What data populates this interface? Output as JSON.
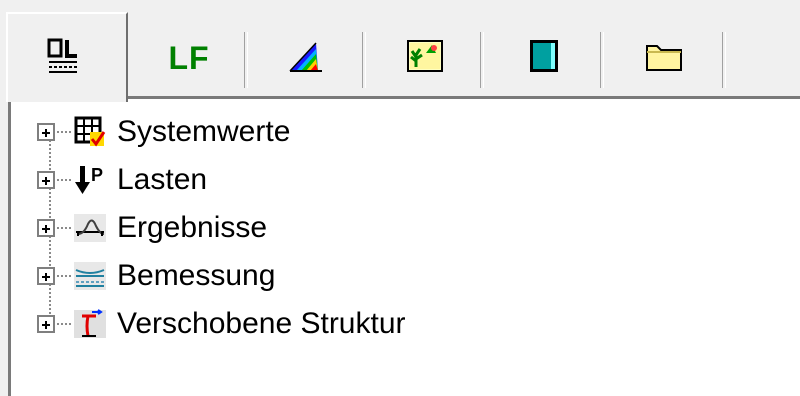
{
  "tabs": [
    {
      "id": "pl",
      "icon": "pl-tab-icon",
      "active": true
    },
    {
      "id": "lf",
      "label": "LF",
      "icon": "lf-text-icon"
    },
    {
      "id": "spectrum",
      "icon": "color-spectrum-icon"
    },
    {
      "id": "plant",
      "icon": "plant-image-icon"
    },
    {
      "id": "cyan",
      "icon": "cyan-frame-icon"
    },
    {
      "id": "folder",
      "icon": "folder-icon"
    }
  ],
  "tree": {
    "items": [
      {
        "label": "Systemwerte",
        "icon": "grid-check-icon",
        "expanded": false
      },
      {
        "label": "Lasten",
        "icon": "load-arrow-icon",
        "expanded": false
      },
      {
        "label": "Ergebnisse",
        "icon": "results-curve-icon",
        "expanded": false
      },
      {
        "label": "Bemessung",
        "icon": "design-beam-icon",
        "expanded": false
      },
      {
        "label": "Verschobene Struktur",
        "icon": "displaced-structure-icon",
        "expanded": false
      }
    ]
  },
  "colors": {
    "panel_bg": "#ffffff",
    "window_bg": "#f0f0f0",
    "lf_green": "#008000",
    "cyan": "#00a0a0",
    "folder_yellow": "#fff4a0"
  }
}
